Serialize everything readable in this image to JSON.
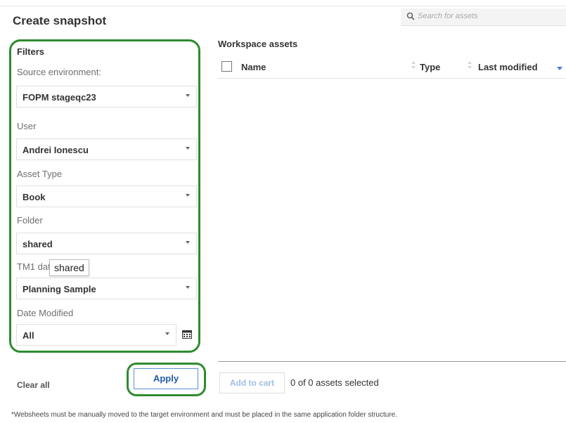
{
  "header": {
    "title": "Create snapshot",
    "search_placeholder": "Search for assets"
  },
  "filters": {
    "title": "Filters",
    "items": [
      {
        "label": "Source environment:",
        "value": "FOPM stageqc23"
      },
      {
        "label": "User",
        "value": "Andrei Ionescu"
      },
      {
        "label": "Asset Type",
        "value": "Book"
      },
      {
        "label": "Folder",
        "value": "shared"
      },
      {
        "label": "TM1 databa",
        "value": "Planning Sample"
      },
      {
        "label": "Date Modified",
        "value": "All"
      }
    ],
    "tooltip": "shared",
    "clear_all": "Clear all",
    "apply": "Apply"
  },
  "assets": {
    "title": "Workspace assets",
    "columns": {
      "name": "Name",
      "type": "Type",
      "last_modified": "Last modified"
    },
    "add_to_cart": "Add to cart",
    "selection_count": "0 of 0 assets selected"
  },
  "footnote": "*Websheets must be manually moved to the target environment and must be placed in the same application folder structure.",
  "colors": {
    "highlight": "#2e8b2e",
    "accent": "#1f5ba8"
  }
}
